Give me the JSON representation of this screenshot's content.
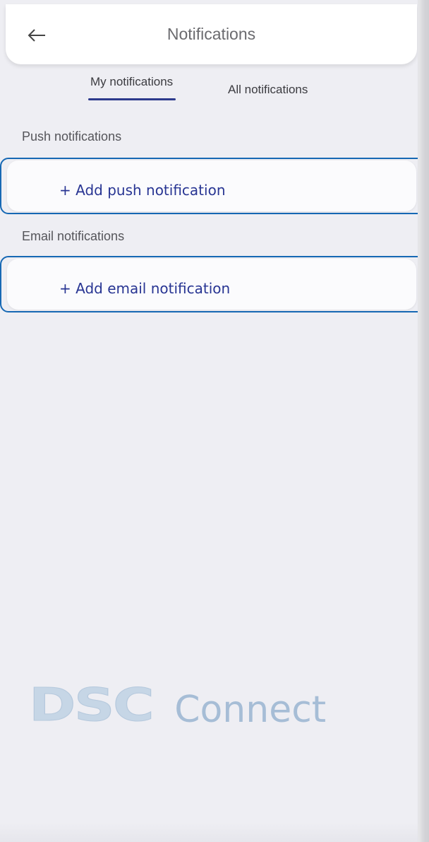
{
  "header": {
    "title": "Notifications",
    "back_icon": "arrow-left-icon"
  },
  "tabs": [
    {
      "label": "My notifications",
      "active": true
    },
    {
      "label": "All notifications",
      "active": false
    }
  ],
  "sections": {
    "push": {
      "heading": "Push notifications",
      "add_label": "+ Add push notification"
    },
    "email": {
      "heading": "Email notifications",
      "add_label": "+ Add email notification"
    }
  },
  "brand": {
    "logo_mark": "DSC",
    "logo_word": "Connect"
  },
  "colors": {
    "accent": "#283593",
    "highlight_border": "#1668b4",
    "tab_underline": "#2d3a8c"
  }
}
